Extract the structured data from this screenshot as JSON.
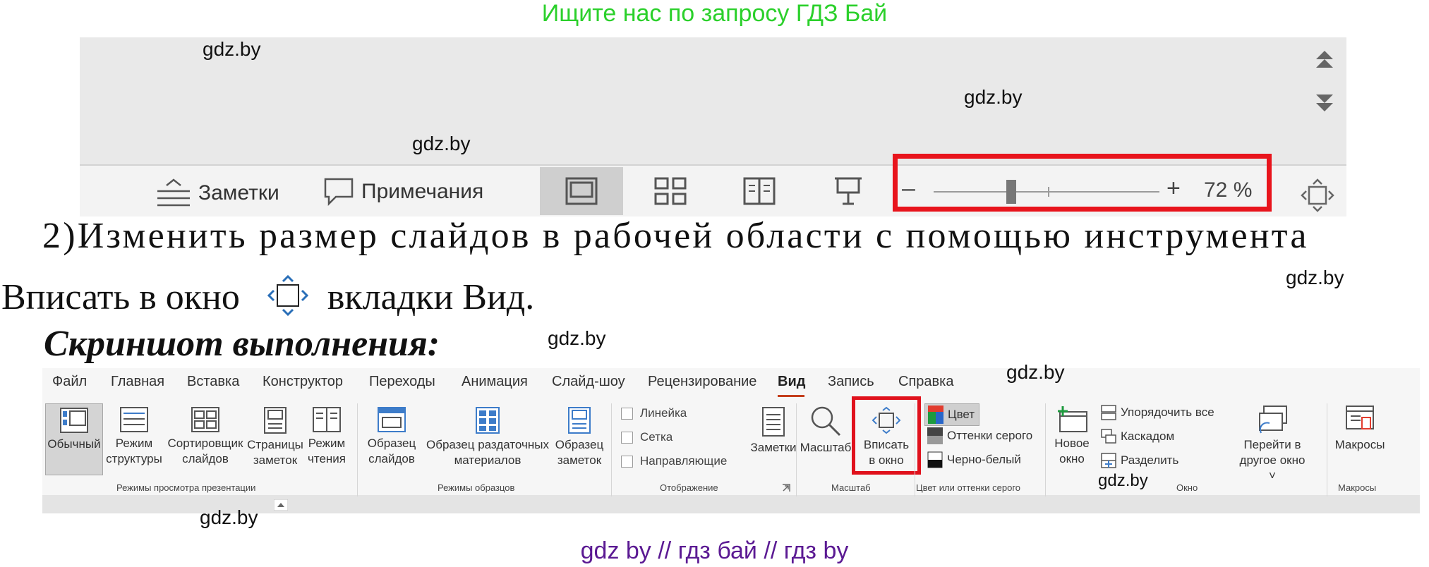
{
  "banners": {
    "top": "Ищите нас по запросу ГДЗ Бай",
    "bottom": "gdz by  //  гдз бай  //  гдз by"
  },
  "watermark": "gdz.by",
  "status_bar": {
    "notes": "Заметки",
    "comments": "Примечания",
    "zoom_minus": "–",
    "zoom_plus": "+",
    "zoom_value": "72 %",
    "zoom_level_percent": 72
  },
  "instruction": {
    "line1": "2)Изменить размер слайдов в рабочей области с помощью инструмента",
    "line2_before": "Вписать в окно",
    "line2_after": "вкладки Вид."
  },
  "heading": "Скриншот выполнения:",
  "ribbon": {
    "tabs": [
      "Файл",
      "Главная",
      "Вставка",
      "Конструктор",
      "Переходы",
      "Анимация",
      "Слайд-шоу",
      "Рецензирование",
      "Вид",
      "Запись",
      "Справка"
    ],
    "active_tab": "Вид",
    "presentation_views": {
      "label": "Режимы просмотра презентации",
      "buttons": [
        [
          "Обычный"
        ],
        [
          "Режим",
          "структуры"
        ],
        [
          "Сортировщик",
          "слайдов"
        ],
        [
          "Страницы",
          "заметок"
        ],
        [
          "Режим",
          "чтения"
        ]
      ]
    },
    "master_views": {
      "label": "Режимы образцов",
      "buttons": [
        [
          "Образец",
          "слайдов"
        ],
        [
          "Образец раздаточных",
          "материалов"
        ],
        [
          "Образец",
          "заметок"
        ]
      ]
    },
    "show": {
      "label": "Отображение",
      "checkboxes": [
        "Линейка",
        "Сетка",
        "Направляющие"
      ],
      "notes": "Заметки"
    },
    "zoom": {
      "label": "Масштаб",
      "zoom_button": "Масштаб",
      "fit_button": [
        "Вписать",
        "в окно"
      ]
    },
    "color": {
      "label": "Цвет или оттенки серого",
      "items": [
        "Цвет",
        "Оттенки серого",
        "Черно-белый"
      ]
    },
    "window": {
      "label": "Окно",
      "new_window": [
        "Новое",
        "окно"
      ],
      "items": [
        "Упорядочить все",
        "Каскадом",
        "Разделить"
      ],
      "switch": [
        "Перейти в",
        "другое окно ˅"
      ]
    },
    "macros": {
      "label": "Макросы",
      "button": "Макросы"
    }
  }
}
